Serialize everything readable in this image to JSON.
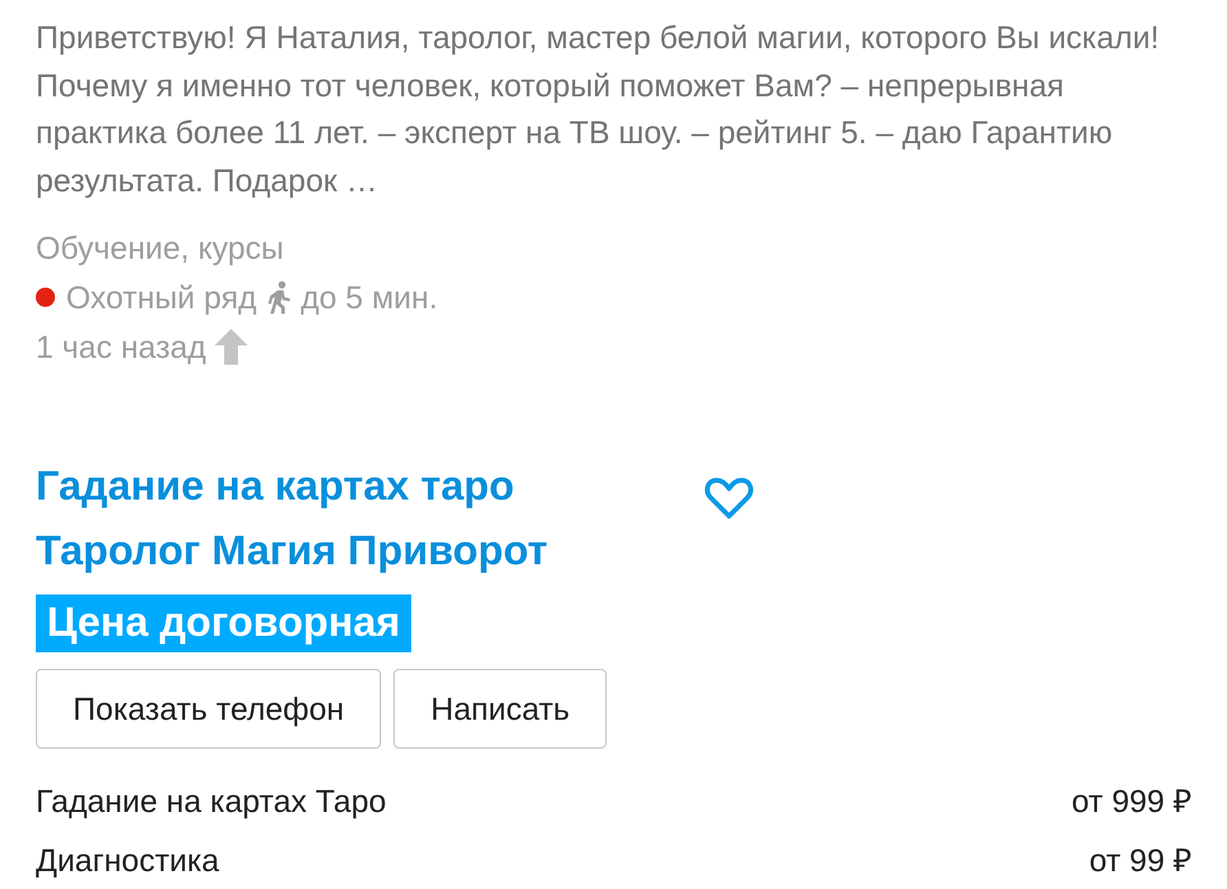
{
  "description": "Приветствую! Я Наталия, таролог, мастер белой магии, которого Вы искали! Почему я именно тот человек, который поможет Вам? – непрерывная практика более 11 лет. – эксперт на ТВ шоу. – рейтинг 5. – даю Гарантию результата. Подарок …",
  "category": "Обучение, курсы",
  "metro": {
    "station": "Охотный ряд",
    "color": "#e42313",
    "walk": "до 5 мин."
  },
  "time": "1 час назад",
  "promoted": true,
  "listing": {
    "title_lines": [
      "Гадание на картах таро",
      "Таролог Магия Приворот"
    ],
    "favorite": false,
    "price": "Цена договорная"
  },
  "buttons": [
    "Показать телефон",
    "Написать"
  ],
  "services": [
    {
      "name": "Гадание на картах Таро",
      "price": "от 999 ₽"
    },
    {
      "name": "Диагностика",
      "price": "от 99 ₽"
    }
  ]
}
